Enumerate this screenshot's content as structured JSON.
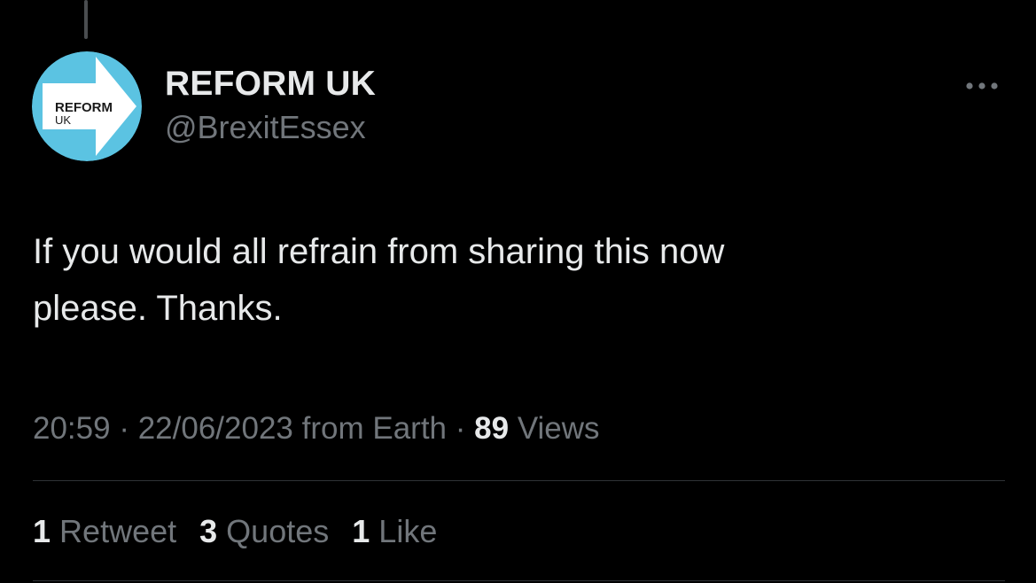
{
  "author": {
    "display_name": "REFORM UK",
    "handle": "@BrexitEssex",
    "avatar_logo": {
      "line1": "REFORM",
      "line2": "UK",
      "bg_color": "#5bc3e2",
      "arrow_color": "#ffffff",
      "text_color": "#1a1a1a"
    }
  },
  "more_icon": "more-horizontal-icon",
  "tweet": {
    "text_line1": "If you would all refrain from sharing this now",
    "text_line2": "please. Thanks."
  },
  "meta": {
    "time": "20:59",
    "sep1": "·",
    "date": "22/06/2023",
    "source": "from Earth",
    "sep2": "·",
    "views_count": "89",
    "views_label": "Views"
  },
  "stats": {
    "retweets_count": "1",
    "retweets_label": "Retweet",
    "quotes_count": "3",
    "quotes_label": "Quotes",
    "likes_count": "1",
    "likes_label": "Like"
  },
  "colors": {
    "background": "#000000",
    "primary_text": "#e7e9ea",
    "secondary_text": "#71767b",
    "divider": "#2f3336"
  }
}
